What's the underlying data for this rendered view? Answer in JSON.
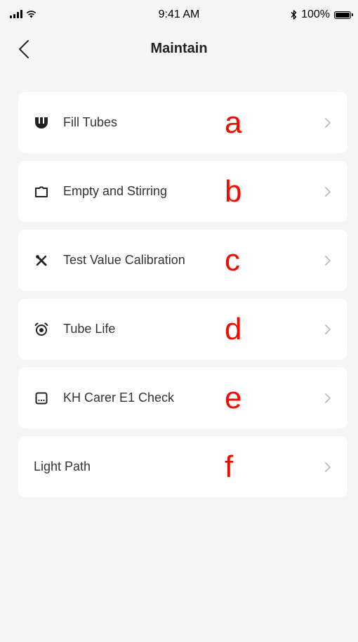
{
  "status_bar": {
    "time": "9:41 AM",
    "battery": "100%",
    "icons": [
      "signal-icon",
      "wifi-icon",
      "bluetooth-icon",
      "battery-icon"
    ]
  },
  "nav": {
    "title": "Maintain",
    "back_icon": "chevron-left-icon"
  },
  "items": [
    {
      "label": "Fill Tubes",
      "marker": "a",
      "icon": "tubes-icon"
    },
    {
      "label": "Empty and Stirring",
      "marker": "b",
      "icon": "container-icon"
    },
    {
      "label": "Test Value Calibration",
      "marker": "c",
      "icon": "tools-icon"
    },
    {
      "label": "Tube Life",
      "marker": "d",
      "icon": "alarm-icon"
    },
    {
      "label": "KH Carer E1 Check",
      "marker": "e",
      "icon": "screen-icon"
    },
    {
      "label": "Light Path",
      "marker": "f",
      "icon": ""
    }
  ],
  "colors": {
    "background": "#f5f5f5",
    "card": "#ffffff",
    "marker": "#f20b00",
    "chevron": "#b8b8b8"
  }
}
